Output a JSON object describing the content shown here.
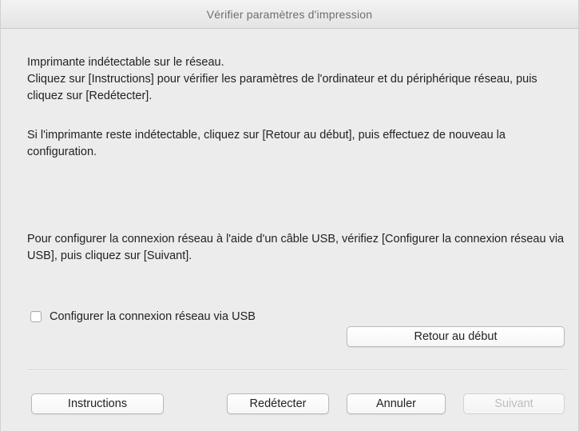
{
  "window": {
    "title": "Vérifier paramètres d'impression"
  },
  "messages": {
    "line_1": "Imprimante indétectable sur le réseau.",
    "line_2": "Cliquez sur [Instructions] pour vérifier les paramètres de l'ordinateur et du périphérique réseau, puis cliquez sur [Redétecter].",
    "line_3": "Si l'imprimante reste indétectable, cliquez sur [Retour au début], puis effectuez de nouveau la configuration.",
    "line_4": "Pour configurer la connexion réseau à l'aide d'un câble USB, vérifiez [Configurer la connexion réseau via USB], puis cliquez sur [Suivant]."
  },
  "checkbox": {
    "label": "Configurer la connexion réseau via USB",
    "checked": false
  },
  "buttons": {
    "return_to_start": "Retour au début",
    "instructions": "Instructions",
    "redetect": "Redétecter",
    "cancel": "Annuler",
    "next": "Suivant",
    "next_enabled": false
  }
}
